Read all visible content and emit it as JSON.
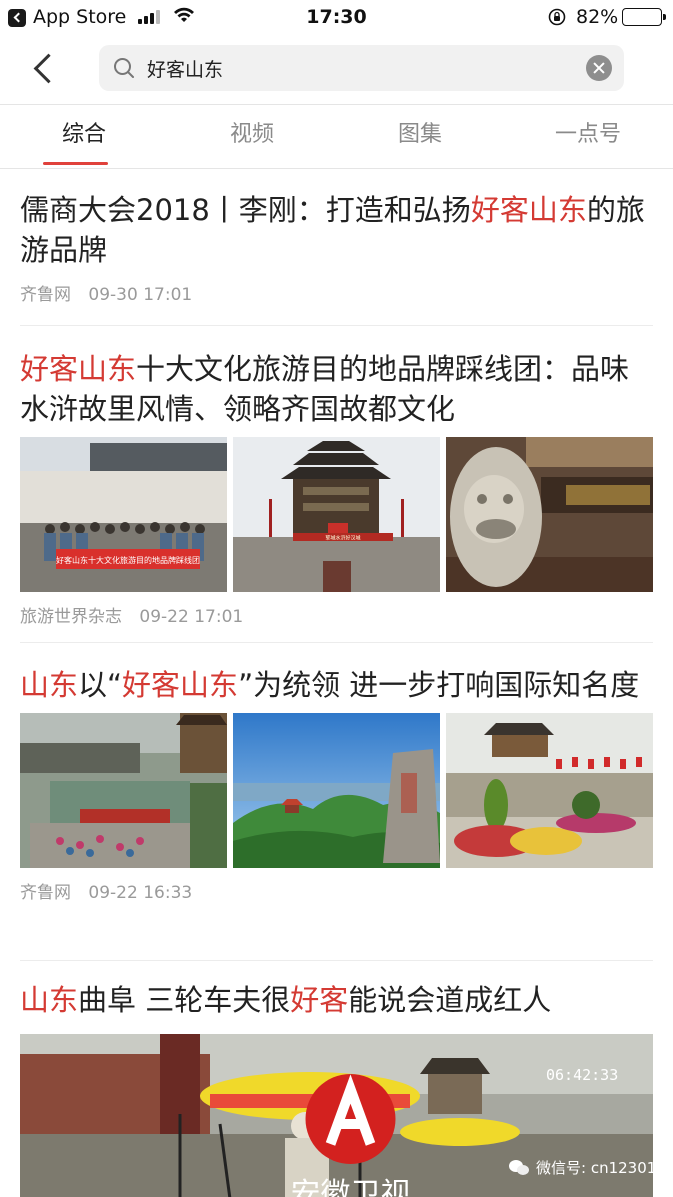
{
  "status_bar": {
    "back_app": "App Store",
    "time": "17:30",
    "battery": "82%",
    "battery_level": 0.82
  },
  "search": {
    "query": "好客山东",
    "placeholder": ""
  },
  "tabs": [
    {
      "label": "综合",
      "active": true
    },
    {
      "label": "视频",
      "active": false
    },
    {
      "label": "图集",
      "active": false
    },
    {
      "label": "一点号",
      "active": false
    }
  ],
  "articles": [
    {
      "title_parts": [
        {
          "text": "儒商大会2018丨李刚：打造和弘扬",
          "hl": false
        },
        {
          "text": "好客山东",
          "hl": true
        },
        {
          "text": "的旅游品牌",
          "hl": false
        }
      ],
      "source": "齐鲁网",
      "time": "09-30 17:01"
    },
    {
      "title_parts": [
        {
          "text": "好客山东",
          "hl": true
        },
        {
          "text": "十大文化旅游目的地品牌踩线团：品味水浒故里风情、领略齐国故都文化",
          "hl": false
        }
      ],
      "source": "旅游世界杂志",
      "time": "09-22 17:01",
      "images": [
        {
          "icon": "group-photo-banner-icon",
          "banner_text": "好客山东十大文化旅游目的地品牌踩线团"
        },
        {
          "icon": "pagoda-gate-icon",
          "banner_text": "郓城水浒好汉城"
        },
        {
          "icon": "stone-lion-icon",
          "banner_text": ""
        }
      ]
    },
    {
      "title_parts": [
        {
          "text": "山东",
          "hl": true
        },
        {
          "text": "以“",
          "hl": false
        },
        {
          "text": "好客山东",
          "hl": true
        },
        {
          "text": "”为统领 进一步打响国际知名度",
          "hl": false
        }
      ],
      "source": "齐鲁网",
      "time": "09-22 16:33",
      "images": [
        {
          "icon": "aerial-town-icon"
        },
        {
          "icon": "mountain-pavilion-icon"
        },
        {
          "icon": "city-gate-flowers-icon"
        }
      ]
    },
    {
      "title_parts": [
        {
          "text": "山东",
          "hl": true
        },
        {
          "text": "曲阜 三轮车夫很",
          "hl": false
        },
        {
          "text": "好客",
          "hl": true
        },
        {
          "text": "能说会道成红人",
          "hl": false
        }
      ],
      "video": {
        "timestamp": "06:42:33",
        "channel": "安徽卫视"
      }
    }
  ],
  "watermark": "微信号: cn12301",
  "colors": {
    "highlight": "#d43a33",
    "tab_indicator": "#e0413b",
    "meta_text": "#9a9a9a"
  }
}
